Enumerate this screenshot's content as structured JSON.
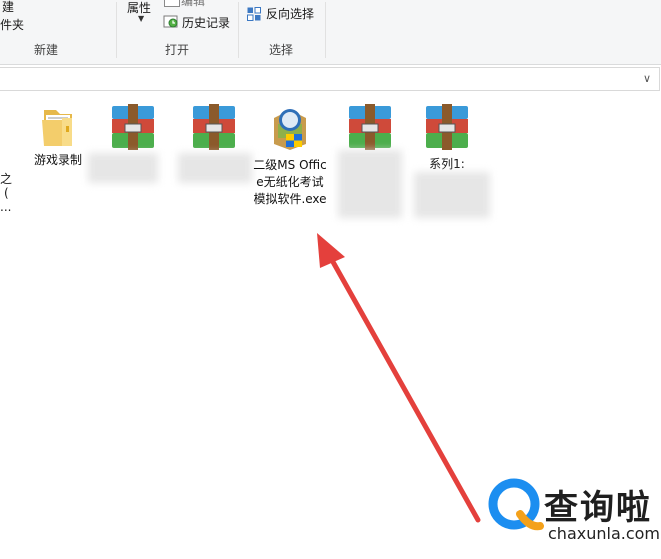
{
  "ribbon": {
    "new_group": {
      "name": "新建",
      "item1": "建",
      "item2": "件夹"
    },
    "open_group": {
      "name": "打开",
      "properties": "属性",
      "edit": "编辑",
      "history": "历史记录"
    },
    "select_group": {
      "name": "选择",
      "invert": "反向选择"
    }
  },
  "address": {
    "dropdown": "∨"
  },
  "files": [
    {
      "name": "游戏录制"
    },
    {
      "name": "二级MS Office无纸化考试模拟软件.exe"
    },
    {
      "name": "系列1:"
    }
  ],
  "left_cut_text": [
    "之",
    "(",
    "..."
  ],
  "watermark": {
    "title": "查询啦",
    "url": "chaxunla.com"
  },
  "colors": {
    "arrow": "#e4403c",
    "logo_blue": "#1c8ef0",
    "logo_orange": "#f4a11a"
  }
}
